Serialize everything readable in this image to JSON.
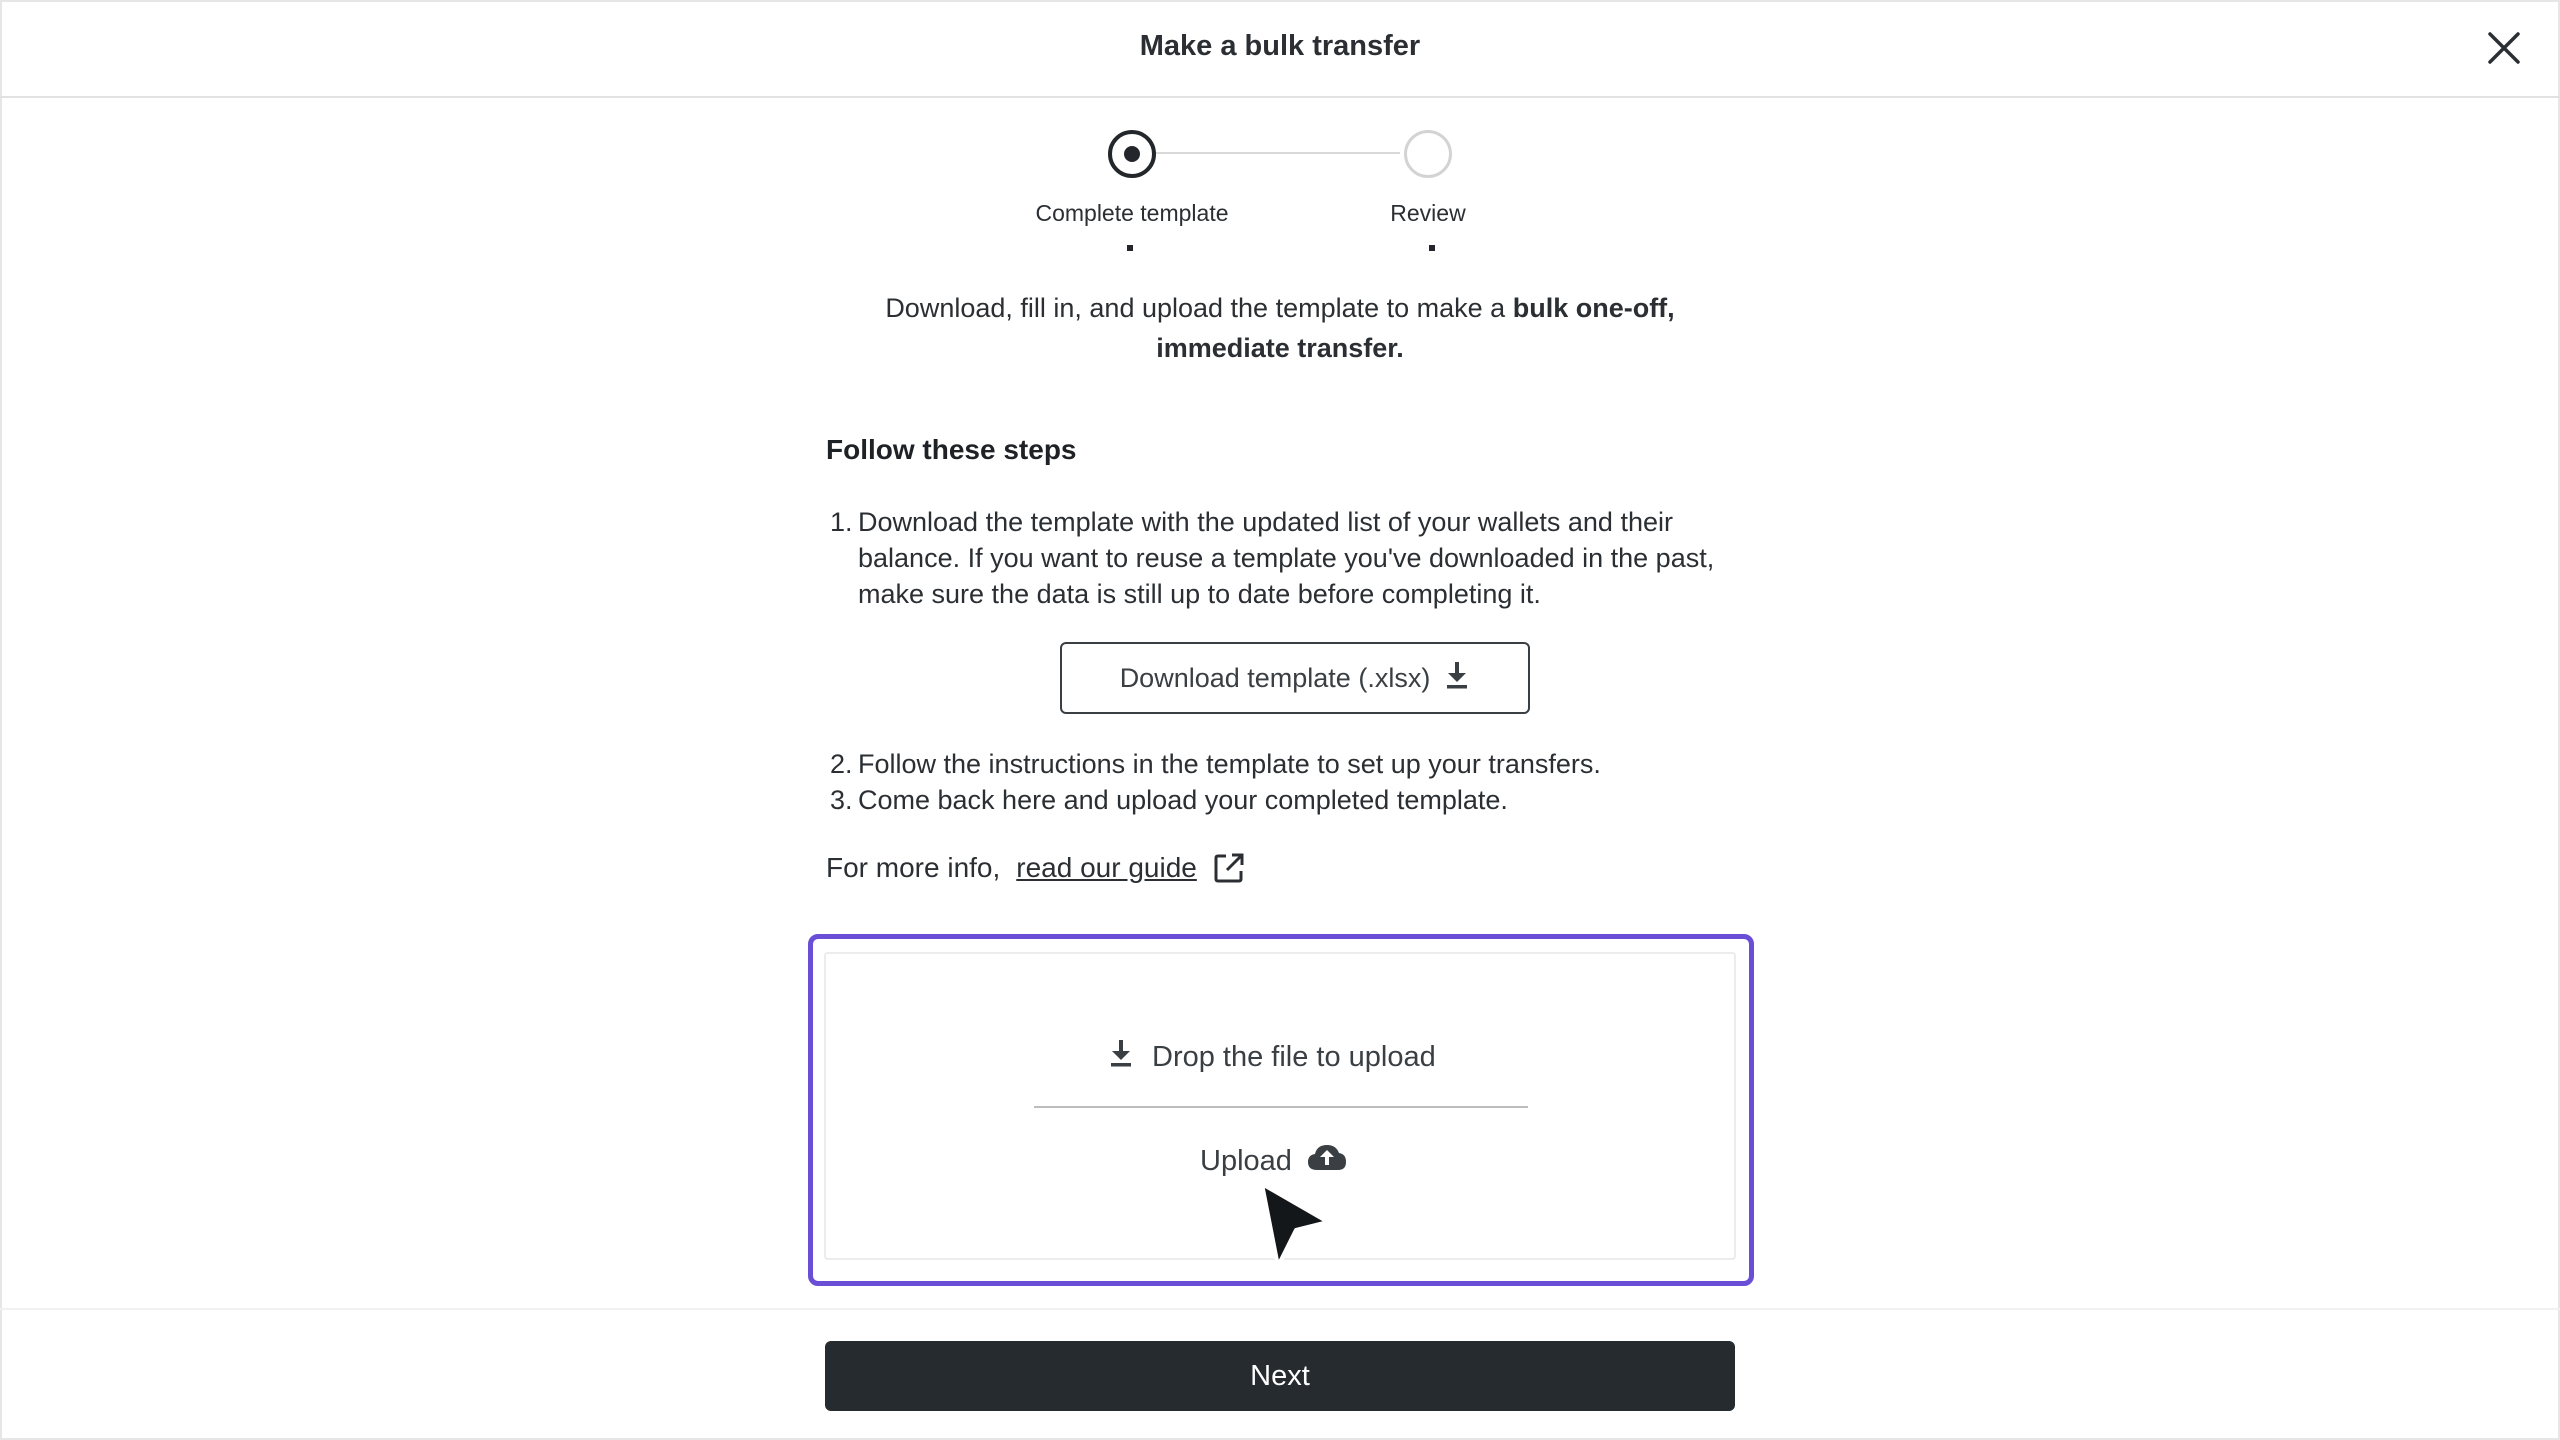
{
  "header": {
    "title": "Make a bulk transfer",
    "close_icon": "close-icon"
  },
  "stepper": {
    "steps": [
      {
        "label": "Complete template",
        "state": "active"
      },
      {
        "label": "Review",
        "state": "inactive"
      }
    ]
  },
  "intro": {
    "text": "Download, fill in, and upload the template to make a ",
    "bold": "bulk one-off, immediate transfer."
  },
  "instructions": {
    "heading": "Follow these steps",
    "items": [
      {
        "num": "1.",
        "text": "Download the template with the updated list of your wallets and their balance. If you want to reuse a template you've downloaded in the past, make sure the data is still up to date before completing it."
      },
      {
        "num": "2.",
        "text": "Follow the instructions in the template to set up your transfers."
      },
      {
        "num": "3.",
        "text": "Come back here and upload your completed template."
      }
    ],
    "download_button": "Download template (.xlsx)",
    "more_info_prefix": "For more info,",
    "guide_link": "read our guide"
  },
  "upload": {
    "drop_text": "Drop the file to upload",
    "upload_label": "Upload"
  },
  "footer": {
    "next_label": "Next"
  },
  "colors": {
    "focus_outline": "#6a4fd6",
    "primary_button": "#262b2f",
    "text": "#2b2f33"
  }
}
